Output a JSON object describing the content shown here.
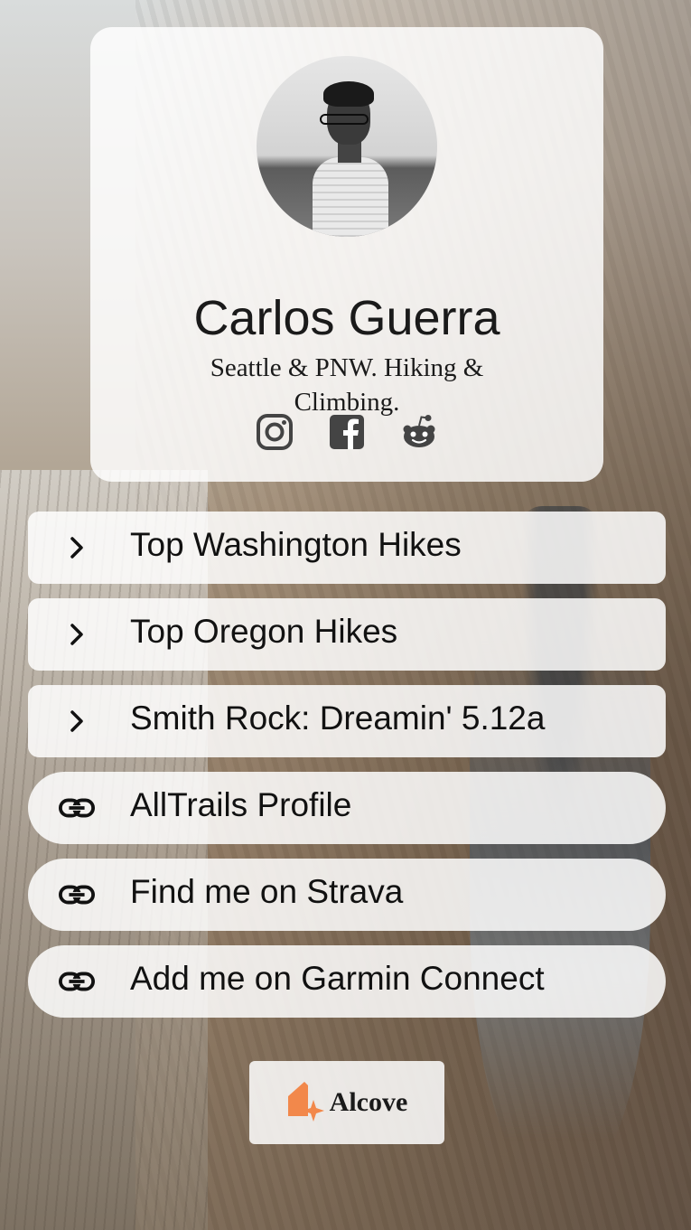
{
  "profile": {
    "name": "Carlos Guerra",
    "bio": "Seattle & PNW. Hiking & Climbing.",
    "socials": [
      {
        "icon": "instagram-icon"
      },
      {
        "icon": "facebook-icon"
      },
      {
        "icon": "reddit-icon"
      }
    ]
  },
  "links": [
    {
      "label": "Top Washington Hikes",
      "icon": "chevron-right-icon",
      "style": "square"
    },
    {
      "label": "Top Oregon Hikes",
      "icon": "chevron-right-icon",
      "style": "square"
    },
    {
      "label": "Smith Rock: Dreamin' 5.12a",
      "icon": "chevron-right-icon",
      "style": "square"
    },
    {
      "label": "AllTrails Profile",
      "icon": "link-icon",
      "style": "pill"
    },
    {
      "label": "Find me on Strava",
      "icon": "link-icon",
      "style": "pill"
    },
    {
      "label": "Add me on Garmin Connect",
      "icon": "link-icon",
      "style": "pill"
    }
  ],
  "footer": {
    "brand": "Alcove",
    "brand_color": "#F2884B"
  }
}
